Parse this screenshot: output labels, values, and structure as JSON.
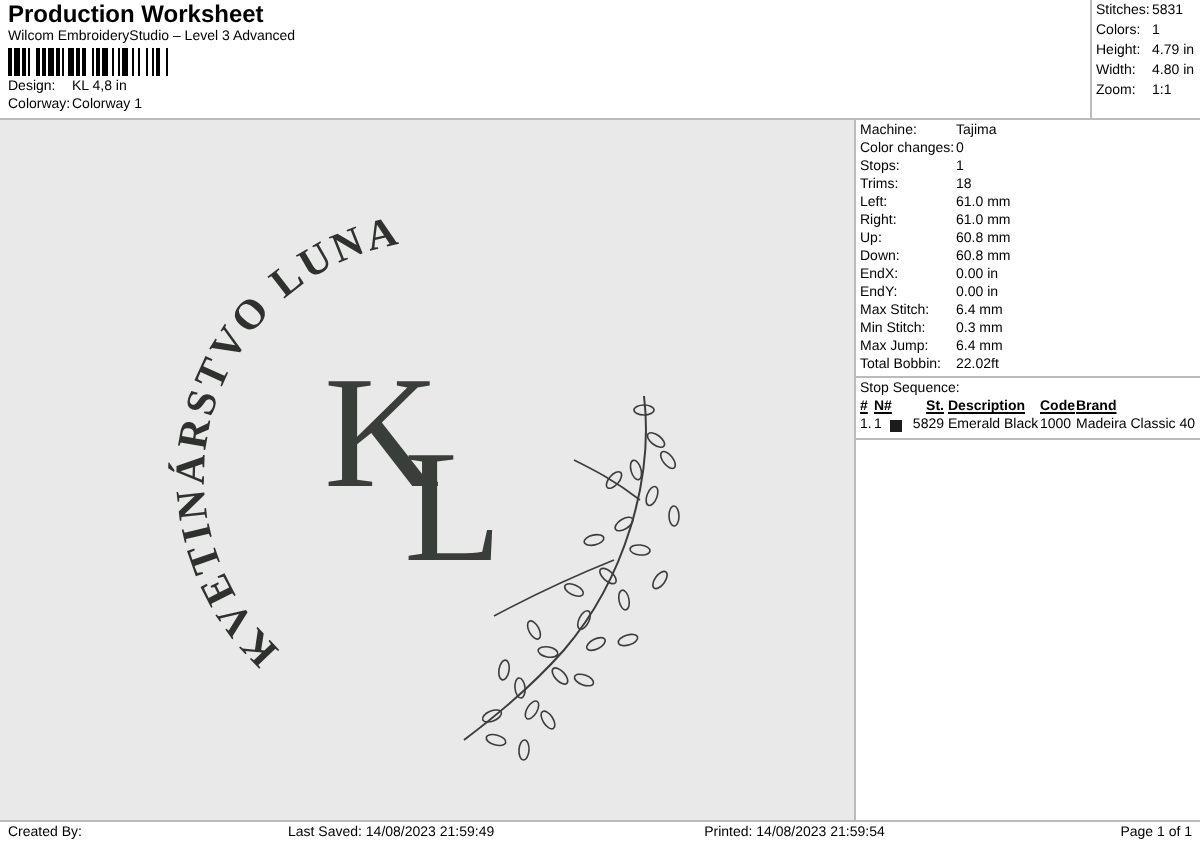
{
  "header": {
    "title": "Production Worksheet",
    "subtitle": "Wilcom EmbroideryStudio – Level 3 Advanced",
    "fields": [
      {
        "label": "Design:",
        "value": "KL 4,8 in"
      },
      {
        "label": "Colorway:",
        "value": "Colorway 1"
      }
    ]
  },
  "summary": [
    {
      "label": "Stitches:",
      "value": "5831"
    },
    {
      "label": "Colors:",
      "value": "1"
    },
    {
      "label": "Height:",
      "value": "4.79 in"
    },
    {
      "label": "Width:",
      "value": "4.80 in"
    },
    {
      "label": "Zoom:",
      "value": "1:1"
    }
  ],
  "design": {
    "arc_text": "KVETINÁRSTVO LUNA",
    "monogram_first": "K",
    "monogram_second": "L"
  },
  "details": [
    {
      "label": "Machine:",
      "value": "Tajima"
    },
    {
      "label": "Color changes:",
      "value": "0"
    },
    {
      "label": "Stops:",
      "value": "1"
    },
    {
      "label": "Trims:",
      "value": "18"
    },
    {
      "label": "Left:",
      "value": "61.0 mm"
    },
    {
      "label": "Right:",
      "value": "61.0 mm"
    },
    {
      "label": "Up:",
      "value": "60.8 mm"
    },
    {
      "label": "Down:",
      "value": "60.8 mm"
    },
    {
      "label": "EndX:",
      "value": "0.00 in"
    },
    {
      "label": "EndY:",
      "value": "0.00 in"
    },
    {
      "label": "Max Stitch:",
      "value": "6.4 mm"
    },
    {
      "label": "Min Stitch:",
      "value": "0.3 mm"
    },
    {
      "label": "Max Jump:",
      "value": "6.4 mm"
    },
    {
      "label": "Total Bobbin:",
      "value": "22.02ft"
    }
  ],
  "stop_sequence": {
    "title": "Stop Sequence:",
    "columns": [
      "#",
      "N#",
      "St.",
      "Description",
      "Code",
      "Brand"
    ],
    "rows": [
      {
        "index": "1.",
        "n": "1",
        "color": "#1c1c1c",
        "stitches": "5829",
        "description": "Emerald Black",
        "code": "1000",
        "brand": "Madeira Classic 40"
      }
    ]
  },
  "footer": {
    "created": "Created By:",
    "saved": "Last Saved: 14/08/2023 21:59:49",
    "printed": "Printed: 14/08/2023 21:59:54",
    "page": "Page 1 of 1"
  }
}
